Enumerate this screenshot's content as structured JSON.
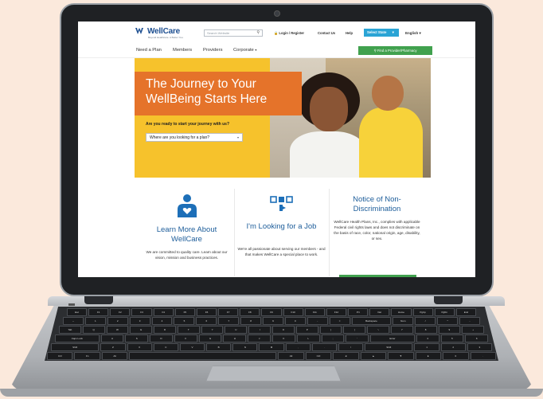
{
  "site": {
    "logo_text": "WellCare",
    "logo_tagline": "Beyond Healthcare. A Better You.",
    "search_placeholder": "Search Website",
    "login_label": "Login / Register",
    "contact_label": "Contact Us",
    "help_label": "Help",
    "state_label": "Select State",
    "language_label": "English"
  },
  "nav": {
    "items": [
      "Need a Plan",
      "Members",
      "Providers",
      "Corporate"
    ],
    "find_button": "Find a Provider/Pharmacy"
  },
  "hero": {
    "title": "The Journey to Your WellBeing Starts Here",
    "question": "Are you ready to start your journey with us?",
    "select_placeholder": "Where are you looking for a plan?"
  },
  "cards": [
    {
      "title": "Learn More About WellCare",
      "text": "We are committed to quality care. Learn about our vision, mission and business practices."
    },
    {
      "title": "I'm Looking for a Job",
      "text": "We're all passionate about serving our members - and that makes WellCare a special place to work."
    },
    {
      "title": "Notice of Non-Discrimination",
      "text": "WellCare Health Plans, Inc., complies with applicable Federal civil rights laws and does not discriminate on the basis of race, color, national origin, age, disability, or sex."
    }
  ],
  "keyboard": {
    "rows": [
      [
        "Esc",
        "F1",
        "F2",
        "F3",
        "F4",
        "F5",
        "F6",
        "F7",
        "F8",
        "F9",
        "F10",
        "F11",
        "F12",
        "Prt",
        "Del",
        "Home",
        "PgUp",
        "PgDn",
        "End"
      ],
      [
        "~",
        "1",
        "2",
        "3",
        "4",
        "5",
        "6",
        "7",
        "8",
        "9",
        "0",
        "-",
        "=",
        "Backspace",
        "Num",
        "/",
        "*",
        "-"
      ],
      [
        "Tab",
        "Q",
        "W",
        "E",
        "R",
        "T",
        "Y",
        "U",
        "I",
        "O",
        "P",
        "[",
        "]",
        "\\",
        "7",
        "8",
        "9",
        "+"
      ],
      [
        "Caps Lock",
        "A",
        "S",
        "D",
        "F",
        "G",
        "H",
        "J",
        "K",
        "L",
        ";",
        "'",
        "Enter",
        "4",
        "5",
        "6"
      ],
      [
        "Shift",
        "Z",
        "X",
        "C",
        "V",
        "B",
        "N",
        "M",
        ",",
        ".",
        "/",
        "Shift",
        "1",
        "2",
        "3"
      ],
      [
        "Ctrl",
        "Fn",
        "Alt",
        "",
        "Alt",
        "Ctrl",
        "◄",
        "▲",
        "▼",
        "►",
        "0",
        "."
      ]
    ]
  }
}
